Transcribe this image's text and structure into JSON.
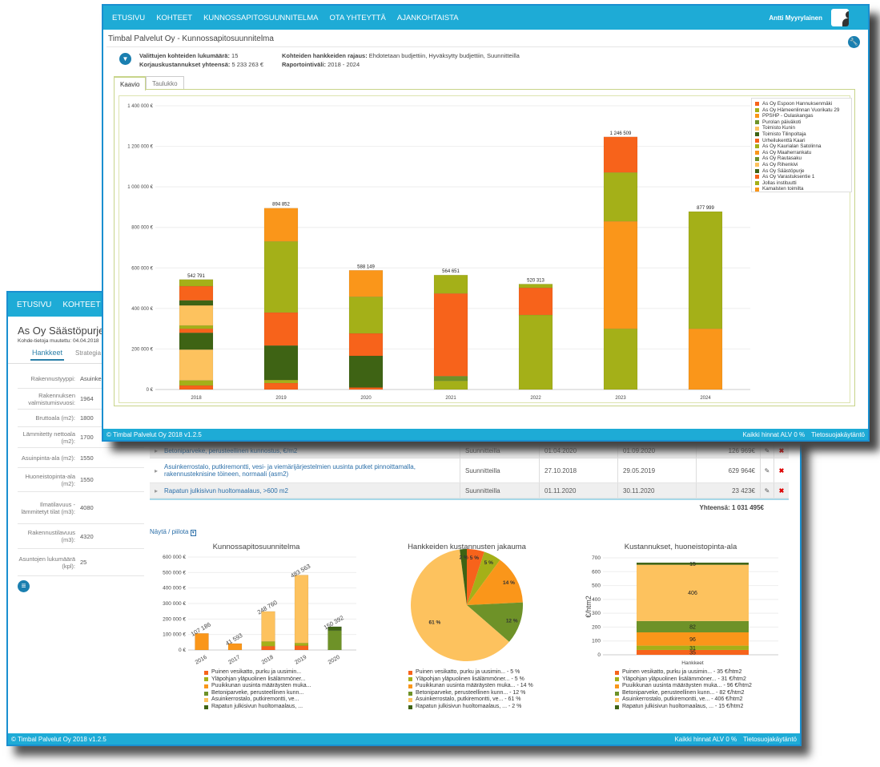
{
  "colors": {
    "red": "#f7631b",
    "olive": "#a4b018",
    "orange": "#fa961a",
    "green": "#6e9228",
    "light": "#fdc25e",
    "dark": "#3e6314",
    "nav": "#1eabd6"
  },
  "back": {
    "nav": [
      "ETUSIVU",
      "KOHTEET"
    ],
    "title": "As Oy Säästöpurje",
    "modified": "Kohde-tietoja muutettu: 04.04.2018",
    "tabs": [
      "Hankkeet",
      "Strategia"
    ],
    "props": [
      {
        "k": "Rakennustyyppi:",
        "v": "Asuinke"
      },
      {
        "k": "Rakennuksen valmistumisvuosi:",
        "v": "1964"
      },
      {
        "k": "Bruttoala (m2):",
        "v": "1800"
      },
      {
        "k": "Lämmitetty nettoala (m2):",
        "v": "1700"
      },
      {
        "k": "Asuinpinta-ala (m2):",
        "v": "1550"
      },
      {
        "k": "Huoneistopinta-ala (m2):",
        "v": "1550"
      },
      {
        "k": "Ilmatilavuus - lämmitetyt tilat (m3):",
        "v": "4080"
      },
      {
        "k": "Rakennustilavuus (m3):",
        "v": "4320"
      },
      {
        "k": "Asuntojen lukumäärä (kpl):",
        "v": "25"
      }
    ],
    "rows": [
      {
        "name": "Betoniparveke, perusteellinen kunnostus, €/m2",
        "status": "Suunnitteilla",
        "start": "01.04.2020",
        "end": "01.09.2020",
        "cost": "126 969€"
      },
      {
        "name": "Asuinkerrostalo, putkiremontti, vesi- ja viemärijärjestelmien uusinta putket pinnoittamalla, rakennusteknisine töineen, normaali (asm2)",
        "status": "Suunnitteilla",
        "start": "27.10.2018",
        "end": "29.05.2019",
        "cost": "629 964€"
      },
      {
        "name": "Rapatun julkisivun huoltomaalaus, >600 m2",
        "status": "Suunnitteilla",
        "start": "01.11.2020",
        "end": "30.11.2020",
        "cost": "23 423€"
      }
    ],
    "total": "Yhteensä: 1 031 495€",
    "toggle": "Näytä / piilota",
    "footer": {
      "left": "© Timbal Palvelut Oy 2018 v1.2.5",
      "vat": "Kaikki hinnat ALV 0 %",
      "privacy": "Tietosuojakäytäntö"
    }
  },
  "front": {
    "nav": [
      "ETUSIVU",
      "KOHTEET",
      "KUNNOSSAPITOSUUNNITELMA",
      "OTA YHTEYTTÄ",
      "AJANKOHTAISTA"
    ],
    "user": "Antti Myyrylainen",
    "title": "Timbal Palvelut Oy - Kunnossapitosuunnitelma",
    "info": {
      "count_label": "Valittujen kohteiden lukumäärä:",
      "count": " 15",
      "cost_label": "Korjauskustannukset yhteensä:",
      "cost": " 5 233 263 €",
      "filter_label": "Kohteiden hankkeiden rajaus:",
      "filter": " Ehdotetaan budjettiin, Hyväksytty budjettiin, Suunnitteilla",
      "interval_label": "Raportointiväli:",
      "interval": " 2018 - 2024"
    },
    "tabs": [
      "Kaavio",
      "Taulukko"
    ],
    "footer": {
      "left": "© Timbal Palvelut Oy 2018 v1.2.5",
      "vat": "Kaikki hinnat ALV 0 %",
      "privacy": "Tietosuojakäytäntö"
    }
  },
  "chart_data": [
    {
      "type": "bar",
      "stacked": true,
      "title": "",
      "ylim": [
        0,
        1400000
      ],
      "yticks": [
        "0 €",
        "200 000 €",
        "400 000 €",
        "600 000 €",
        "800 000 €",
        "1 000 000 €",
        "1 200 000 €",
        "1 400 000 €"
      ],
      "categories": [
        "2018",
        "2019",
        "2020",
        "2021",
        "2022",
        "2023",
        "2024"
      ],
      "totals": [
        "542 791",
        "894 852",
        "588 149",
        "564 651",
        "520 313",
        "1 246 509",
        "877 999"
      ],
      "segments": [
        [
          [
            "red",
            20000
          ],
          [
            "olive",
            25000
          ],
          [
            "light",
            152000
          ],
          [
            "dark",
            83000
          ],
          [
            "red",
            20000
          ],
          [
            "olive",
            16000
          ],
          [
            "light",
            99000
          ],
          [
            "dark",
            25000
          ],
          [
            "red",
            70000
          ],
          [
            "olive",
            32791
          ]
        ],
        [
          [
            "red",
            32000
          ],
          [
            "olive",
            15000
          ],
          [
            "dark",
            170000
          ],
          [
            "red",
            163000
          ],
          [
            "olive",
            351000
          ],
          [
            "orange",
            163852
          ]
        ],
        [
          [
            "red",
            10000
          ],
          [
            "dark",
            156000
          ],
          [
            "red",
            111000
          ],
          [
            "olive",
            181000
          ],
          [
            "orange",
            130149
          ]
        ],
        [
          [
            "olive",
            43000
          ],
          [
            "green",
            23000
          ],
          [
            "red",
            408000
          ],
          [
            "olive",
            90651
          ]
        ],
        [
          [
            "olive",
            368000
          ],
          [
            "red",
            134000
          ],
          [
            "olive",
            18313
          ]
        ],
        [
          [
            "olive",
            300000
          ],
          [
            "orange",
            530000
          ],
          [
            "olive",
            241000
          ],
          [
            "red",
            175509
          ]
        ],
        [
          [
            "orange",
            300000
          ],
          [
            "olive",
            577999
          ]
        ]
      ],
      "legend": [
        {
          "name": "As Oy Espoon Hannuksenmäki",
          "color": "red"
        },
        {
          "name": "As Oy Hämeenlinnan Vuorikatu 29",
          "color": "olive"
        },
        {
          "name": "PPSHP - Oulaskangas",
          "color": "orange"
        },
        {
          "name": "Purolan päiväkoti",
          "color": "green"
        },
        {
          "name": "Toimisto Kunin",
          "color": "light"
        },
        {
          "name": "Toimisto Tilinpoltaja",
          "color": "dark"
        },
        {
          "name": "Urheilukenttä Kaari",
          "color": "red"
        },
        {
          "name": "As Oy Kaurialan Satolinna",
          "color": "olive"
        },
        {
          "name": "As Oy Maaherrankatu",
          "color": "orange"
        },
        {
          "name": "As Oy Rautasaku",
          "color": "green"
        },
        {
          "name": "As Oy Rihenkivi",
          "color": "light"
        },
        {
          "name": "As Oy Säästöpurje",
          "color": "dark"
        },
        {
          "name": "As Oy Varastuksentie 1",
          "color": "red"
        },
        {
          "name": "Jollas instituutti",
          "color": "olive"
        },
        {
          "name": "Kamalsten toimilta",
          "color": "orange"
        }
      ]
    },
    {
      "type": "bar",
      "stacked": true,
      "title": "Kunnossapitosuunnitelma",
      "ylim": [
        0,
        600000
      ],
      "yticks": [
        "0 €",
        "100 000 €",
        "200 000 €",
        "300 000 €",
        "400 000 €",
        "500 000 €",
        "600 000 €"
      ],
      "categories": [
        "2016",
        "2017",
        "2018",
        "2019",
        "2020"
      ],
      "totals": [
        "107 186",
        "41 593",
        "248 760",
        "483 563",
        "150 392"
      ],
      "segments": [
        [
          [
            "orange",
            107186
          ]
        ],
        [
          [
            "orange",
            41593
          ]
        ],
        [
          [
            "red",
            25000
          ],
          [
            "olive",
            30000
          ],
          [
            "light",
            193760
          ]
        ],
        [
          [
            "red",
            28000
          ],
          [
            "olive",
            17000
          ],
          [
            "light",
            438563
          ]
        ],
        [
          [
            "green",
            125000
          ],
          [
            "dark",
            25392
          ]
        ]
      ],
      "legend": [
        {
          "name": "Puinen vesikatto, purku ja uusimin...",
          "color": "red"
        },
        {
          "name": "Yläpohjan yläpuolinen lisälämmöner...",
          "color": "olive"
        },
        {
          "name": "Puuikkunan uusinta määräysten muka...",
          "color": "orange"
        },
        {
          "name": "Betoniparveke, perusteellinen kunn...",
          "color": "green"
        },
        {
          "name": "Asuinkerrostalo, putkiremontti, ve...",
          "color": "light"
        },
        {
          "name": "Rapatun julkisivun huoltomaalaus, ...",
          "color": "dark"
        }
      ]
    },
    {
      "type": "pie",
      "title": "Hankkeiden kustannusten jakauma",
      "slices": [
        {
          "value": 5,
          "label": "5 %",
          "color": "red"
        },
        {
          "value": 5,
          "label": "5 %",
          "color": "olive"
        },
        {
          "value": 14,
          "label": "14 %",
          "color": "orange"
        },
        {
          "value": 12,
          "label": "12 %",
          "color": "green"
        },
        {
          "value": 61,
          "label": "61 %",
          "color": "light"
        },
        {
          "value": 2,
          "label": "2 %",
          "color": "dark"
        }
      ],
      "legend": [
        {
          "name": "Puinen vesikatto, purku ja uusimin... - 5 %",
          "color": "red"
        },
        {
          "name": "Yläpohjan yläpuolinen lisälämmöner... - 5 %",
          "color": "olive"
        },
        {
          "name": "Puuikkunan uusinta määräysten muka... - 14 %",
          "color": "orange"
        },
        {
          "name": "Betoniparveke, perusteellinen kunn... - 12 %",
          "color": "green"
        },
        {
          "name": "Asuinkerrostalo, putkiremontti, ve... - 61 %",
          "color": "light"
        },
        {
          "name": "Rapatun julkisivun huoltomaalaus, ... - 2 %",
          "color": "dark"
        }
      ]
    },
    {
      "type": "bar",
      "stacked": true,
      "title": "Kustannukset, huoneistopinta-ala",
      "ylabel": "€/htm2",
      "xlabel": "Hankkeet",
      "ylim": [
        0,
        700
      ],
      "yticks": [
        "0",
        "100",
        "200",
        "300",
        "400",
        "500",
        "600",
        "700"
      ],
      "segments": [
        [
          "red",
          35,
          "35"
        ],
        [
          "olive",
          31,
          "31"
        ],
        [
          "orange",
          96,
          "96"
        ],
        [
          "green",
          82,
          "82"
        ],
        [
          "light",
          406,
          "406"
        ],
        [
          "dark",
          15,
          "15"
        ]
      ],
      "legend": [
        {
          "name": "Puinen vesikatto, purku ja uusimin... - 35 €/htm2",
          "color": "red"
        },
        {
          "name": "Yläpohjan yläpuolinen lisälämmöner... - 31 €/htm2",
          "color": "olive"
        },
        {
          "name": "Puuikkunan uusinta määräysten muka... - 96 €/htm2",
          "color": "orange"
        },
        {
          "name": "Betoniparveke, perusteellinen kunn... - 82 €/htm2",
          "color": "green"
        },
        {
          "name": "Asuinkerrostalo, putkiremontti, ve... - 406 €/htm2",
          "color": "light"
        },
        {
          "name": "Rapatun julkisivun huoltomaalaus, ... - 15 €/htm2",
          "color": "dark"
        }
      ]
    }
  ]
}
